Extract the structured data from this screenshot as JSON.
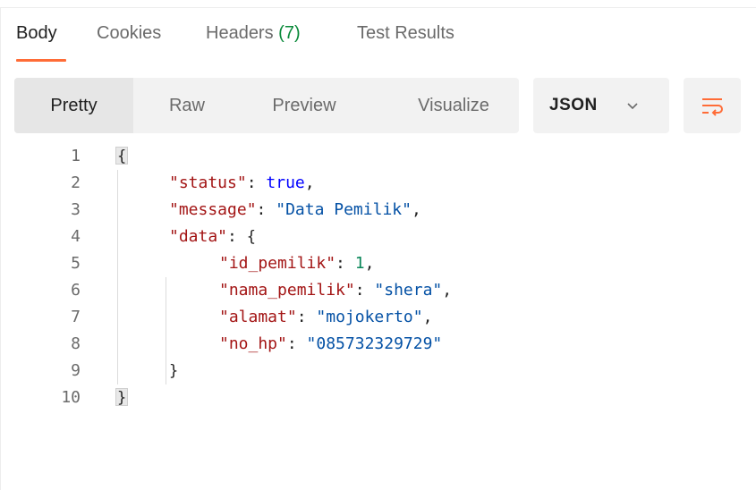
{
  "tabs": {
    "body": "Body",
    "cookies": "Cookies",
    "headers": "Headers",
    "headers_count": "(7)",
    "tests": "Test Results"
  },
  "view_modes": {
    "pretty": "Pretty",
    "raw": "Raw",
    "preview": "Preview",
    "visualize": "Visualize"
  },
  "format": {
    "label": "JSON"
  },
  "icons": {
    "chevron": "chevron-down-icon",
    "wrap": "wrap-lines-icon"
  },
  "colors": {
    "accent": "#ff6c37",
    "key": "#a31515",
    "string": "#0451a5",
    "number": "#098658",
    "keyword": "#0000ff"
  },
  "code": {
    "line_numbers": [
      "1",
      "2",
      "3",
      "4",
      "5",
      "6",
      "7",
      "8",
      "9",
      "10"
    ],
    "open_brace": "{",
    "close_brace": "}",
    "status_key": "\"status\"",
    "status_val": "true",
    "message_key": "\"message\"",
    "message_val": "\"Data Pemilik\"",
    "data_key": "\"data\"",
    "id_key": "\"id_pemilik\"",
    "id_val": "1",
    "nama_key": "\"nama_pemilik\"",
    "nama_val": "\"shera\"",
    "alamat_key": "\"alamat\"",
    "alamat_val": "\"mojokerto\"",
    "hp_key": "\"no_hp\"",
    "hp_val": "\"085732329729\"",
    "colon": ": ",
    "comma": ","
  }
}
